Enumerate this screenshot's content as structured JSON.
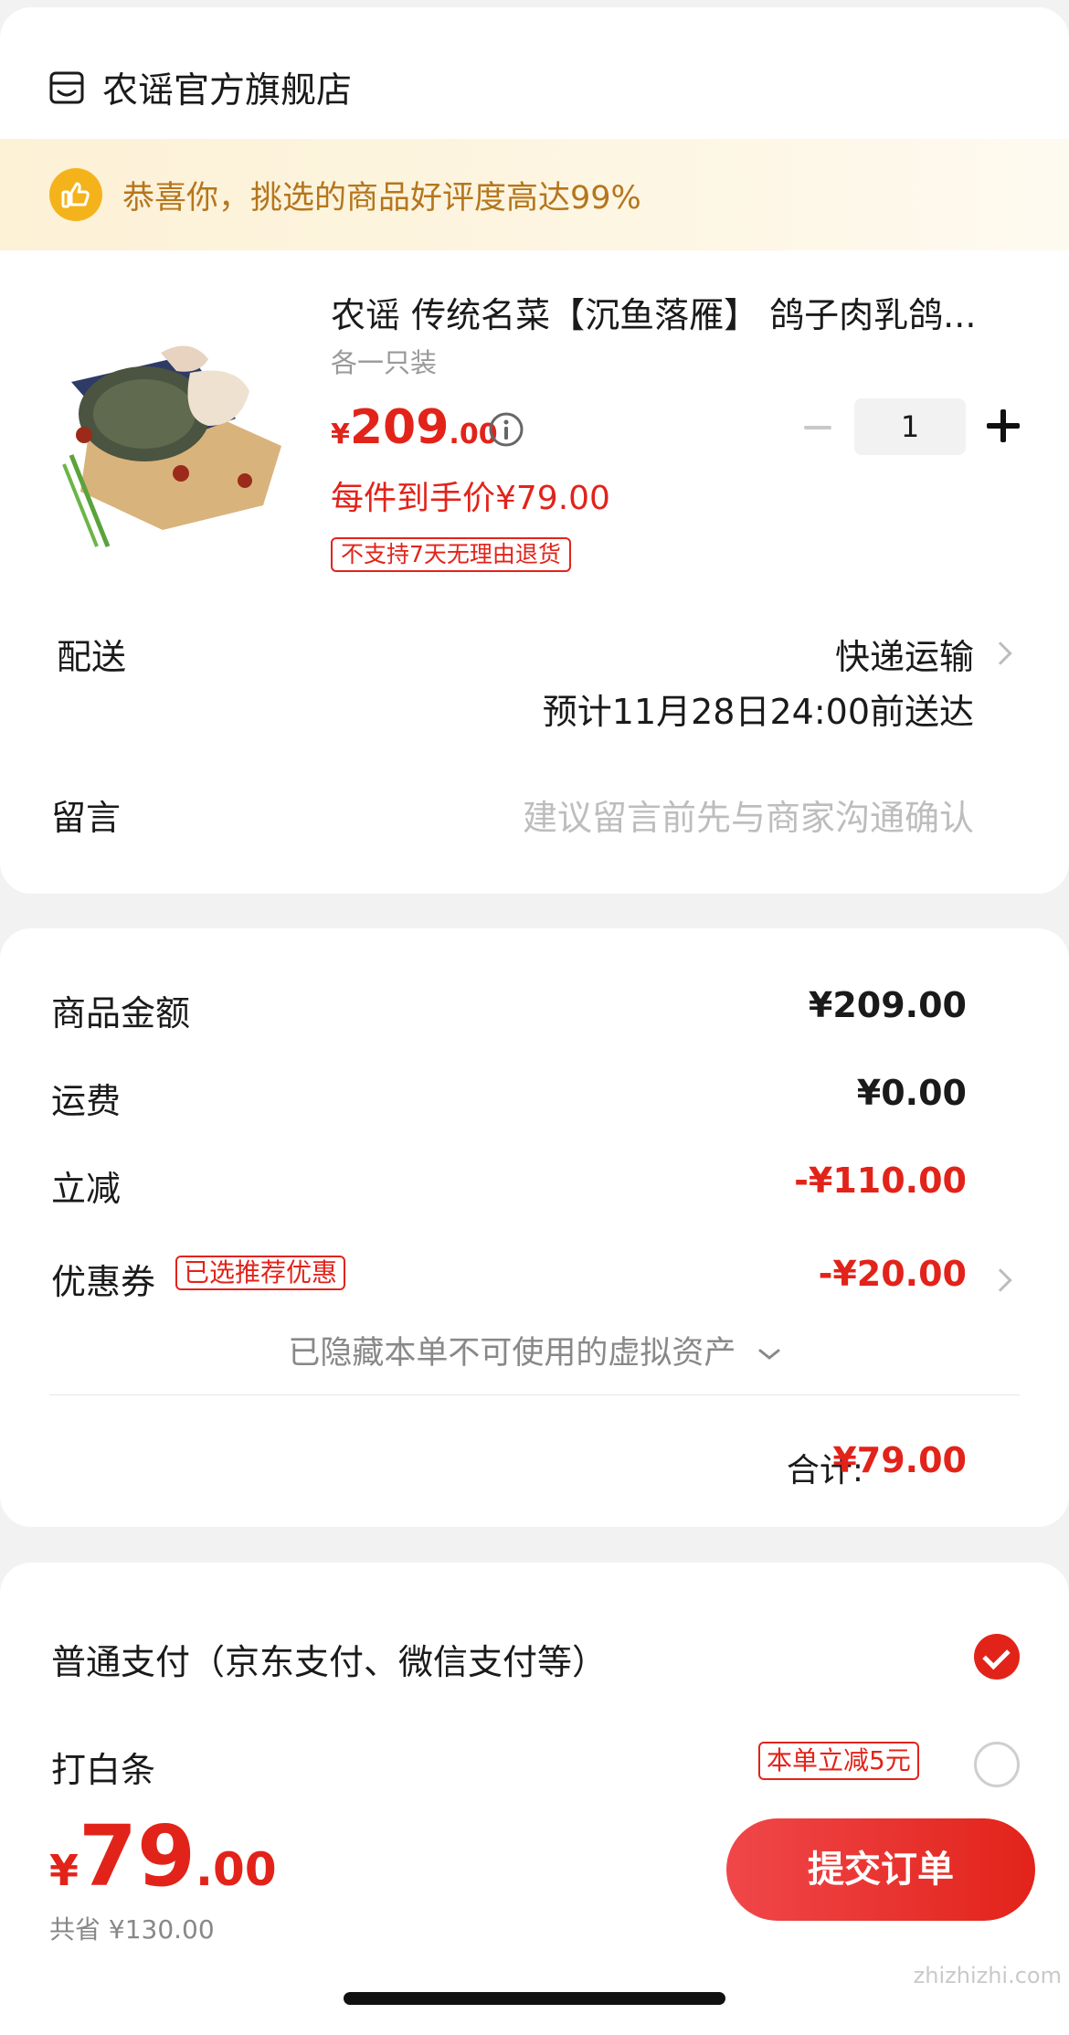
{
  "store": {
    "name": "农谣官方旗舰店",
    "icon": "store-icon"
  },
  "banner": {
    "text": "恭喜你，挑选的商品好评度高达99%",
    "icon": "thumbs-up-icon"
  },
  "product": {
    "title": "农谣 传统名菜【沉鱼落雁】 鸽子肉乳鸽...",
    "spec": "各一只装",
    "price_symbol": "¥",
    "price_int": "209",
    "price_dec": ".00",
    "unit_price": "每件到手价¥79.00",
    "return_tag": "不支持7天无理由退货",
    "quantity": "1"
  },
  "delivery": {
    "label": "配送",
    "method": "快递运输",
    "eta": "预计11月28日24:00前送达"
  },
  "note": {
    "label": "留言",
    "placeholder": "建议留言前先与商家沟通确认"
  },
  "amounts": {
    "goods_label": "商品金额",
    "goods_value": "¥209.00",
    "shipping_label": "运费",
    "shipping_value": "¥0.00",
    "discount_label": "立减",
    "discount_value": "-¥110.00",
    "coupon_label": "优惠券",
    "coupon_tag": "已选推荐优惠",
    "coupon_value": "-¥20.00",
    "hidden_assets": "已隐藏本单不可使用的虚拟资产",
    "total_label": "合计:",
    "total_value": "¥79.00"
  },
  "payment": {
    "normal_label": "普通支付（京东支付、微信支付等）",
    "normal_selected": true,
    "baitiao_label": "打白条",
    "baitiao_tag": "本单立减5元",
    "baitiao_selected": false
  },
  "bottom": {
    "price_symbol": "¥",
    "price_int": "79",
    "price_dec": ".00",
    "saved": "共省 ¥130.00",
    "submit_label": "提交订单",
    "watermark": "zhizhizhi.com"
  },
  "colors": {
    "accent": "#e2231a",
    "banner_text": "#b5761d",
    "banner_icon": "#f5b31b"
  }
}
